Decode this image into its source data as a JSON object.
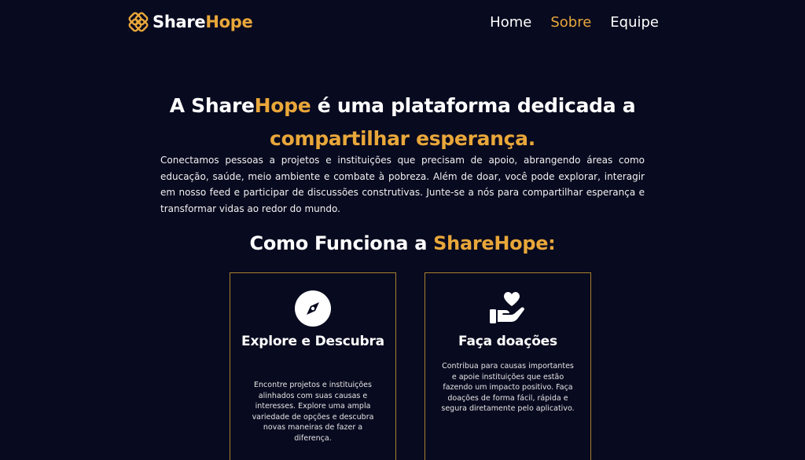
{
  "brand": {
    "name_part1": "Share",
    "name_part2": "Hope",
    "accent_color": "#e9a73a",
    "background_color": "#080a1f",
    "logo_icon": "interlocked-squares-logo-icon"
  },
  "nav": {
    "items": [
      {
        "label": "Home",
        "active": false
      },
      {
        "label": "Sobre",
        "active": true
      },
      {
        "label": "Equipe",
        "active": false
      }
    ]
  },
  "hero": {
    "title_prefix": "A ",
    "title_brand1": "Share",
    "title_brand2": "Hope",
    "title_middle": " é uma plataforma dedicada a",
    "title_highlight": "compartilhar esperança.",
    "description": "Conectamos pessoas a projetos e instituições que precisam de apoio, abrangendo áreas como educação, saúde, meio ambiente e combate à pobreza. Além de doar, você pode explorar, interagir em nosso feed e participar de discussões construtivas. Junte-se a nós para compartilhar esperança e transformar vidas ao redor do mundo."
  },
  "how_it_works": {
    "title_prefix": "Como Funciona a ",
    "title_brand": "ShareHope:",
    "cards": [
      {
        "icon": "compass-icon",
        "title": "Explore e Descubra",
        "text": "Encontre projetos e instituições alinhados com suas causas e interesses. Explore uma ampla variedade de opções e descubra novas maneiras de fazer a diferença."
      },
      {
        "icon": "hand-heart-icon",
        "title": "Faça doações",
        "text": "Contribua para causas importantes e apoie instituições que estão fazendo um impacto positivo. Faça doações de forma fácil, rápida e segura diretamente pelo aplicativo."
      }
    ]
  }
}
